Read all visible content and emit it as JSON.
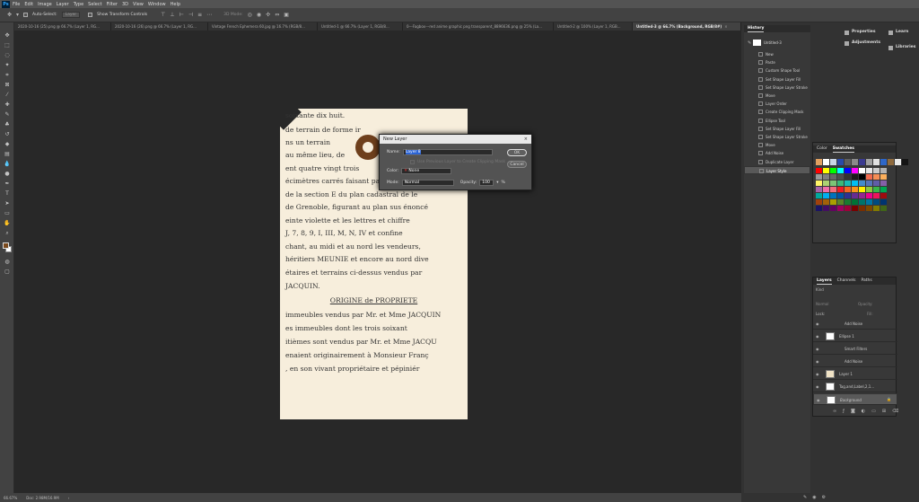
{
  "menu": {
    "logo": "Ps",
    "items": [
      "File",
      "Edit",
      "Image",
      "Layer",
      "Type",
      "Select",
      "Filter",
      "3D",
      "View",
      "Window",
      "Help"
    ]
  },
  "options": {
    "auto_select": "Auto-Select:",
    "auto_select_target": "Layer",
    "show_transform": "Show Transform Controls",
    "mode_3d": "3D Mode:"
  },
  "tabs": [
    {
      "label": "2020-10-16 (25).png @ 66.7% (Layer 1, RG...",
      "active": false
    },
    {
      "label": "2020-10-16 (26).png @ 66.7% (Layer 1, RG...",
      "active": false
    },
    {
      "label": "Vintage French Ephemera 60.jpg @ 16.7% (RGB/8...",
      "active": false
    },
    {
      "label": "Untitled-1 @ 66.7% (Layer 1, RGB/8...",
      "active": false
    },
    {
      "label": "0---Fagbox---red anime graphic png transparent_8896636.png @ 25% (La...",
      "active": false
    },
    {
      "label": "Untitled-2 @ 100% (Layer 1, RGB...",
      "active": false
    },
    {
      "label": "Untitled-3 @ 66.7% (Background, RGB/8#)",
      "active": true
    }
  ],
  "document": {
    "lines": [
      "  soixante dix huit.",
      "   de terrain de forme ir",
      "ns un terrain",
      "au même lieu, de",
      "ent quatre vingt trois",
      "écimètres carrés faisant partie des n°",
      "  de la section E du plan cadastral de le",
      "  de Grenoble, figurant au plan sus énoncé",
      "einte violette et les lettres et chiffre",
      "  J, 7, 8, 9, I, III, M, N, IV et confine",
      "chant, au midi et au nord les vendeurs,",
      "  héritiers MEUNIE et encore au nord dive",
      "étaires et terrains ci-dessus vendus par",
      "   JACQUIN.",
      "ORIGINE de PROPRIETE",
      "immeubles vendus par Mr. et Mme JACQUIN",
      "es immeubles dont les    trois  soixant",
      "itièmes sont vendus par Mr. et Mme JACQU",
      "enaient originairement à Monsieur  Franç",
      "  , en son vivant propriétaire et pépiniér"
    ]
  },
  "dialog": {
    "title": "New Layer",
    "close": "×",
    "name_label": "Name:",
    "name_value": "Layer 8",
    "clip_label": "Use Previous Layer to Create Clipping Mask",
    "color_label": "Color:",
    "color_value": "None",
    "mode_label": "Mode:",
    "mode_value": "Normal",
    "opacity_label": "Opacity:",
    "opacity_value": "100",
    "percent": "%",
    "ok": "OK",
    "cancel": "Cancel"
  },
  "history": {
    "title": "History",
    "snapshot": "Untitled-3",
    "items": [
      "New",
      "Paste",
      "Custom Shape Tool",
      "Set Shape Layer Fill",
      "Set Shape Layer Stroke",
      "Move",
      "Layer Order",
      "Create Clipping Mask",
      "Ellipse Tool",
      "Set Shape Layer Fill",
      "Set Shape Layer Stroke",
      "Move",
      "Add Noise",
      "Duplicate Layer",
      "Layer Style"
    ]
  },
  "right_panels": {
    "properties": "Properties",
    "adjustments": "Adjustments",
    "learn": "Learn",
    "libraries": "Libraries"
  },
  "swatches": {
    "tab_color": "Color",
    "tab_swatches": "Swatches",
    "top": [
      "#e0a060",
      "#ffffff",
      "#c9d6e6",
      "#2b4aa8",
      "#5f5f5f",
      "#8a8a8a",
      "#3b3b8f",
      "#a0a0a0",
      "#e0e0e0",
      "#2e67c9",
      "#8e6a3e",
      "#e9e9e9",
      "#141414"
    ],
    "grid": [
      "#ff0000",
      "#ffff00",
      "#00ff00",
      "#00ffff",
      "#0000ff",
      "#ff00ff",
      "#ffffff",
      "#e6e6e6",
      "#cccccc",
      "#b3b3b3",
      "#999999",
      "#808080",
      "#666666",
      "#4d4d4d",
      "#333333",
      "#1a1a1a",
      "#000000",
      "#f26c4f",
      "#f68e55",
      "#fbaf5c",
      "#fff467",
      "#acd372",
      "#7cc576",
      "#3bb878",
      "#1abbb4",
      "#00bff3",
      "#438ccb",
      "#5574b9",
      "#605ca8",
      "#855fa8",
      "#a763a8",
      "#f06ea9",
      "#f26d7d",
      "#ed1c24",
      "#f26522",
      "#f7941d",
      "#fff200",
      "#8dc73f",
      "#39b54a",
      "#00a651",
      "#00a99d",
      "#00aeef",
      "#0072bc",
      "#0054a6",
      "#2e3192",
      "#662d91",
      "#92278f",
      "#ec008c",
      "#ed145b",
      "#9e0b0f",
      "#a0410d",
      "#a36209",
      "#aba000",
      "#598527",
      "#1a7b30",
      "#007236",
      "#00746b",
      "#0076a3",
      "#004b80",
      "#003471",
      "#1b1464",
      "#440e62",
      "#630460",
      "#9e005d",
      "#9e0039",
      "#790000",
      "#7b2e00",
      "#7d4900",
      "#827b00",
      "#406618"
    ]
  },
  "layers": {
    "tabs": [
      "Layers",
      "Channels",
      "Paths"
    ],
    "kind": "Kind",
    "blend": "Normal",
    "opacity_label": "Opacity:",
    "lock_label": "Lock:",
    "fill_label": "Fill:",
    "rows": [
      {
        "name": "Add Noise",
        "sub": true,
        "sel": false
      },
      {
        "name": "Ellipse 1",
        "sub": false,
        "sel": false
      },
      {
        "name": "Smart Filters",
        "sub": true,
        "sel": false
      },
      {
        "name": "Add Noise",
        "sub": true,
        "sel": false
      },
      {
        "name": "Layer 1",
        "sub": false,
        "sel": false
      },
      {
        "name": "Tag,and,Label,2,1...",
        "sub": false,
        "sel": false
      },
      {
        "name": "Background",
        "sub": false,
        "sel": true
      }
    ]
  },
  "status": {
    "zoom": "66.67%",
    "doc": "Doc: 2.98M/16.9M"
  }
}
